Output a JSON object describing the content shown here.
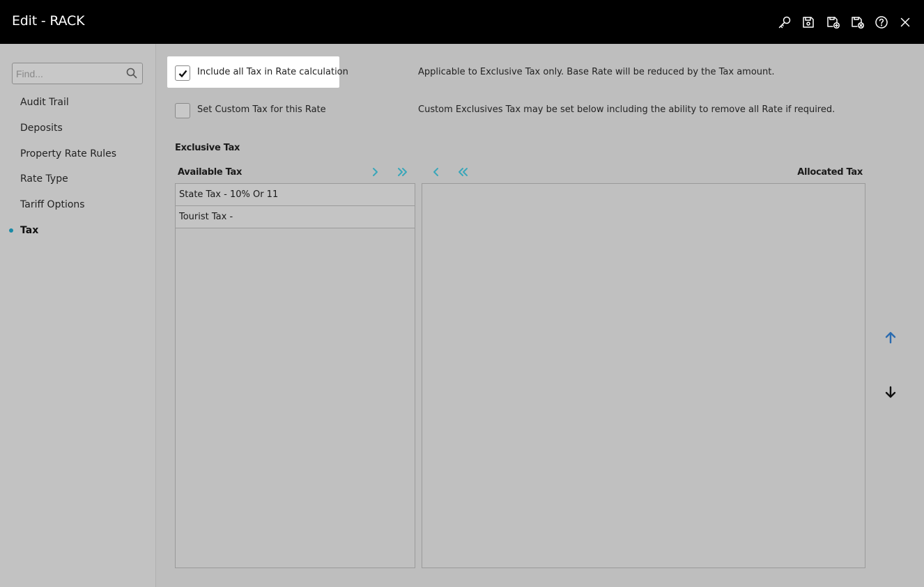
{
  "window": {
    "title": "Edit - RACK",
    "toolbar_icons": [
      "key-icon",
      "save-icon",
      "save-and-new-icon",
      "save-and-close-icon",
      "help-icon",
      "close-icon"
    ]
  },
  "sidebar": {
    "search_placeholder": "Find...",
    "items": [
      {
        "label": "Audit Trail"
      },
      {
        "label": "Deposits"
      },
      {
        "label": "Property Rate Rules"
      },
      {
        "label": "Rate Type"
      },
      {
        "label": "Tariff Options"
      },
      {
        "label": "Tax",
        "active": true
      }
    ]
  },
  "options": [
    {
      "label": "Include all Tax in Rate calculation",
      "checked": true,
      "description": "Applicable to Exclusive Tax only. Base Rate will be reduced by the Tax amount."
    },
    {
      "label": "Set Custom Tax for this Rate",
      "checked": false,
      "description": "Custom Exclusives Tax may be set below including the ability to remove all Rate if required."
    }
  ],
  "exclusive_tax": {
    "title": "Exclusive Tax",
    "available_header": "Available Tax",
    "allocated_header": "Allocated Tax",
    "available_items": [
      "State Tax - 10% Or 11",
      "Tourist Tax -"
    ],
    "allocated_items": []
  },
  "colors": {
    "accent": "#3aa6b9",
    "move_up": "#2b6cb0",
    "move_down": "#111111",
    "topbar": "#000000"
  }
}
